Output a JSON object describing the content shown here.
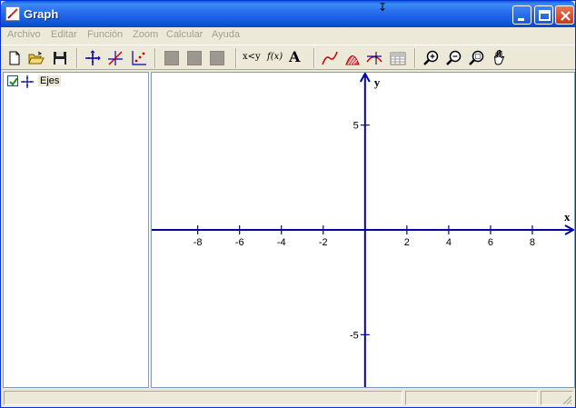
{
  "window": {
    "title": "Graph",
    "icons": {
      "app": "graph-app-icon",
      "minimize": "minimize-icon",
      "maximize": "maximize-icon",
      "close": "close-icon"
    }
  },
  "menu": {
    "items": [
      "Archivo",
      "Editar",
      "Función",
      "Zoom",
      "Calcular",
      "Ayuda"
    ]
  },
  "toolbar": {
    "icons": [
      "new-file-icon",
      "open-folder-icon",
      "save-disk-icon",
      "axes-icon",
      "insert-point-icon",
      "point-series-icon",
      "disabled-square-icon",
      "disabled-square-icon",
      "disabled-square-icon",
      "insert-relation-icon",
      "insert-function-icon",
      "insert-label-icon",
      "trendline-icon",
      "shading-icon",
      "tangent-icon",
      "table-icon",
      "zoom-in-icon",
      "zoom-out-icon",
      "zoom-window-icon",
      "hand-pan-icon"
    ],
    "relation_label": "x<y",
    "function_label": "f(x)",
    "label_glyph": "A"
  },
  "tree": {
    "items": [
      {
        "label": "Ejes",
        "checked": true,
        "icon": "axes-small-icon"
      }
    ]
  },
  "graph": {
    "x_axis_label": "x",
    "y_axis_label": "y",
    "x_ticks": [
      -8,
      -6,
      -4,
      -2,
      2,
      4,
      6,
      8
    ],
    "y_ticks": [
      5,
      -5
    ],
    "x_range": [
      -10.2,
      10.0
    ],
    "y_range": [
      -7.5,
      7.5
    ],
    "axis_color": "#0000b0",
    "show_grid": false
  },
  "status": {
    "panes": [
      "",
      "",
      ""
    ]
  }
}
